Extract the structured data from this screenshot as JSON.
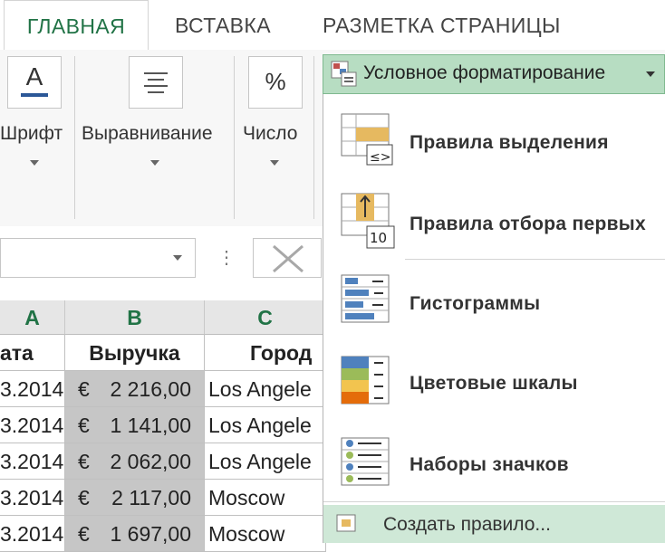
{
  "tabs": [
    {
      "label": "ГЛАВНАЯ",
      "active": true
    },
    {
      "label": "ВСТАВКА",
      "active": false
    },
    {
      "label": "РАЗМЕТКА СТРАНИЦЫ",
      "active": false
    }
  ],
  "ribbon": {
    "font_label": "Шрифт",
    "align_label": "Выравнивание",
    "number_label": "Число",
    "percent_glyph": "%",
    "font_glyph": "A"
  },
  "sheet": {
    "column_headers": [
      "A",
      "B",
      "C"
    ],
    "header_row": [
      "ата",
      "Выручка",
      "Город"
    ],
    "rows": [
      [
        "3.2014",
        "€",
        "2 216,00",
        "Los Angele"
      ],
      [
        "3.2014",
        "€",
        "1 141,00",
        "Los Angele"
      ],
      [
        "3.2014",
        "€",
        "2 062,00",
        "Los Angele"
      ],
      [
        "3.2014",
        "€",
        "2 117,00",
        "Moscow"
      ],
      [
        "3.2014",
        "€",
        "1 697,00",
        "Moscow"
      ]
    ]
  },
  "menu": {
    "title": "Условное форматирование",
    "items": [
      {
        "label": "Правила выделения",
        "icon": "highlight-rules-icon"
      },
      {
        "label": "Правила отбора первых",
        "icon": "top-bottom-rules-icon",
        "badge": "10"
      },
      {
        "label": "Гистограммы",
        "icon": "data-bars-icon"
      },
      {
        "label": "Цветовые шкалы",
        "icon": "color-scales-icon"
      },
      {
        "label": "Наборы значков",
        "icon": "icon-sets-icon"
      }
    ],
    "new_rule": "Создать правило..."
  },
  "colors": {
    "accent": "#217346",
    "menu_header": "#b7ddc2",
    "selected_cells": "#c6c6c6"
  }
}
